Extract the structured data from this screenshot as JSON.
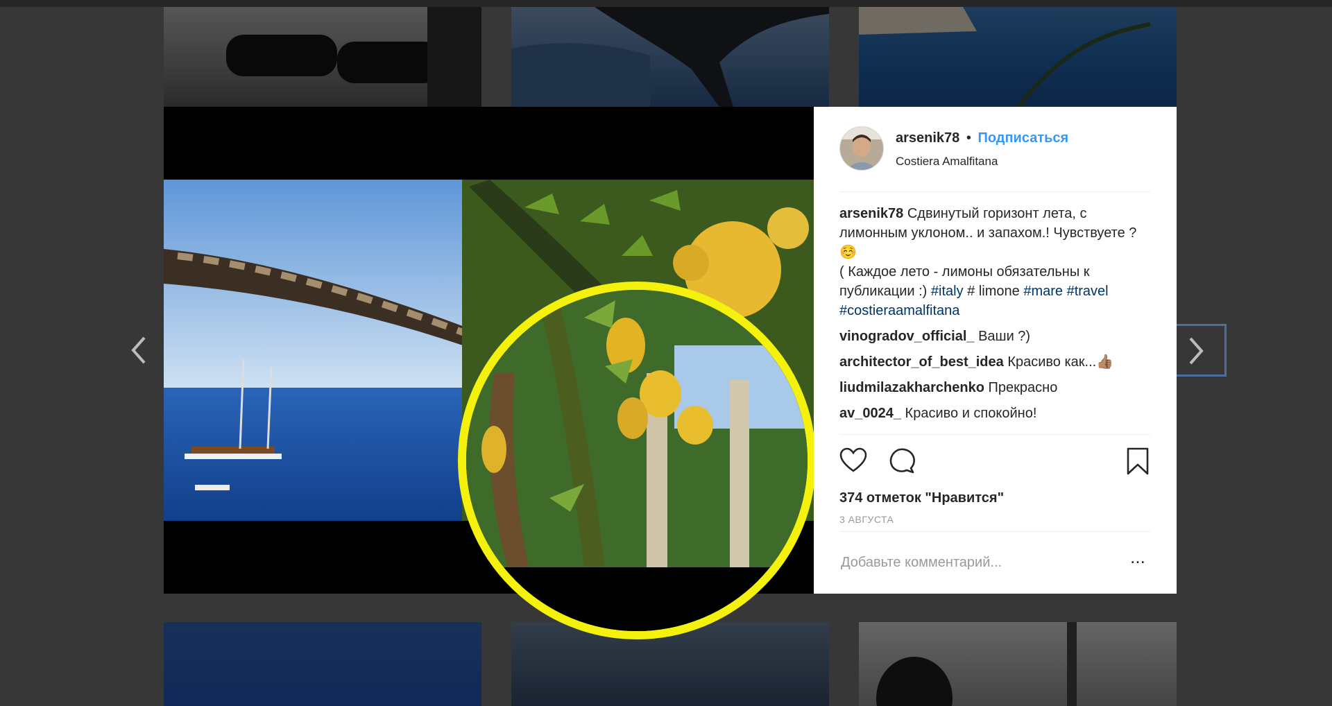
{
  "post": {
    "username": "arsenik78",
    "separator": "•",
    "follow_label": "Подписаться",
    "location": "Costiera Amalfitana"
  },
  "caption": {
    "username": "arsenik78",
    "text_1": "Сдвинутый горизонт лета, с лимонным уклоном.. и запахом.! Чувствуете ? ☺️",
    "text_2": "( Каждое лето - лимоны обязательны к публикации :) ",
    "tag_italy": "#italy",
    "text_3": " # limone ",
    "tag_mare": "#mare",
    "tag_travel": "#travel",
    "tag_costiera": "#costieraamalfitana"
  },
  "comments": [
    {
      "user": "vinogradov_official_",
      "text": "Ваши ?)"
    },
    {
      "user": "architector_of_best_idea",
      "text": "Красиво как...👍🏽"
    },
    {
      "user": "liudmilazakharchenko",
      "text": "Прекрасно"
    },
    {
      "user": "av_0024_",
      "text": "Красиво и спокойно!"
    }
  ],
  "likes": "374 отметок \"Нравится\"",
  "date": "3 АВГУСТА",
  "comment_input": {
    "placeholder": "Добавьте комментарий..."
  },
  "more_label": "...",
  "colors": {
    "link": "#3897f0",
    "hashtag": "#003569",
    "highlight_ring": "#f4f20c"
  }
}
